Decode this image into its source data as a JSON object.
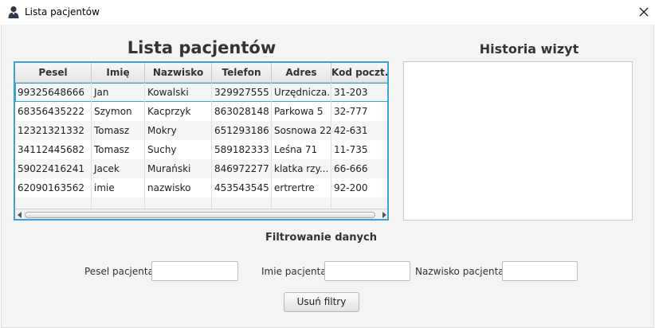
{
  "window": {
    "title": "Lista pacjentów"
  },
  "patients": {
    "heading": "Lista pacjentów",
    "columns": [
      "Pesel",
      "Imię",
      "Nazwisko",
      "Telefon",
      "Adres",
      "Kod poczt..."
    ],
    "rows": [
      [
        "99325648666",
        "Jan",
        "Kowalski",
        "329927555",
        "Urzędnicza...",
        "31-203"
      ],
      [
        "68356435222",
        "Szymon",
        "Kacprzyk",
        "863028148",
        "Parkowa 5",
        "32-777"
      ],
      [
        "12321321332",
        "Tomasz",
        "Mokry",
        "651293186",
        "Sosnowa 22",
        "42-631"
      ],
      [
        "34112445682",
        "Tomasz",
        "Suchy",
        "589182333",
        "Leśna 71",
        "11-735"
      ],
      [
        "59022416241",
        "Jacek",
        "Murański",
        "846972277",
        "klatka rzy...",
        "66-666"
      ],
      [
        "62090163562",
        "imie",
        "nazwisko",
        "453543545",
        "ertrertre",
        "92-200"
      ]
    ]
  },
  "history": {
    "heading": "Historia wizyt"
  },
  "filter": {
    "heading": "Filtrowanie danych",
    "pesel_label": "Pesel pacjenta:",
    "pesel_value": "",
    "name_label": "Imie pacjenta:",
    "name_value": "",
    "surname_label": "Nazwisko pacjenta:",
    "surname_value": "",
    "clear_button": "Usuń filtry"
  }
}
